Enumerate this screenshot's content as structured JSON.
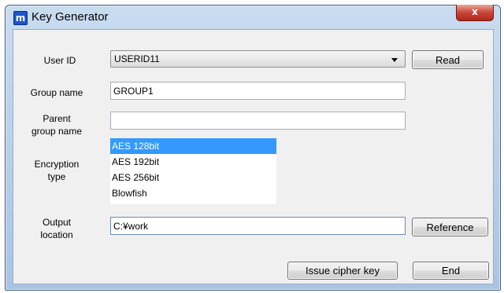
{
  "window": {
    "title": "Key Generator",
    "app_icon_glyph": "m",
    "close_glyph": "x"
  },
  "colors": {
    "selection": "#3399ff",
    "close_button": "#c7463a",
    "titlebar": "#b9d1ea"
  },
  "form": {
    "user_id": {
      "label": "User ID",
      "value": "USERID11"
    },
    "group_name": {
      "label": "Group name",
      "value": "GROUP1"
    },
    "parent_group": {
      "label_line1": "Parent",
      "label_line2": "group name",
      "value": ""
    },
    "encryption": {
      "label_line1": "Encryption",
      "label_line2": "type",
      "options": [
        "AES 128bit",
        "AES 192bit",
        "AES 256bit",
        "Blowfish"
      ],
      "selected": "AES 128bit"
    },
    "output": {
      "label_line1": "Output",
      "label_line2": "location",
      "value": "C:¥work"
    }
  },
  "buttons": {
    "read": "Read",
    "reference": "Reference",
    "issue": "Issue cipher key",
    "end": "End"
  }
}
